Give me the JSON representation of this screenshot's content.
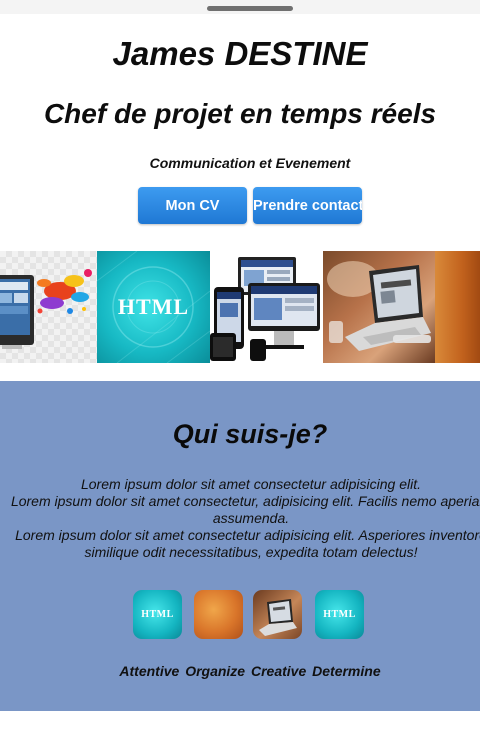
{
  "header": {
    "name": "James DESTINE",
    "subtitle": "Chef de projet en temps réels",
    "tagline": "Communication et Evenement"
  },
  "buttons": {
    "cv": "Mon CV",
    "contact": "Prendre contact"
  },
  "gallery": {
    "tiles": [
      {
        "icon": "colorful-monitor-splash-image"
      },
      {
        "icon": "html-banner-image",
        "text": "HTML"
      },
      {
        "icon": "responsive-devices-image"
      },
      {
        "icon": "laptop-on-desk-image"
      },
      {
        "icon": "orange-abstract-image"
      }
    ]
  },
  "about": {
    "title": "Qui suis-je?",
    "paragraphs": [
      "Lorem ipsum dolor sit amet consectetur adipisicing elit.",
      "Lorem ipsum dolor sit amet consectetur, adipisicing elit. Facilis nemo aperiam assumenda.",
      "Lorem ipsum dolor sit amet consectetur adipisicing elit. Asperiores inventore similique odit necessitatibus, expedita totam delectus!"
    ],
    "icons": [
      {
        "icon": "html-icon",
        "text": "HTML"
      },
      {
        "icon": "orange-abstract-icon"
      },
      {
        "icon": "laptop-icon"
      },
      {
        "icon": "html-icon",
        "text": "HTML"
      }
    ],
    "qualities": [
      "Attentive",
      "Organize",
      "Creative",
      "Determine"
    ]
  },
  "colors": {
    "button": "#2a86e0",
    "about_background": "#7a96c6",
    "html_teal": "#17b9c4"
  }
}
